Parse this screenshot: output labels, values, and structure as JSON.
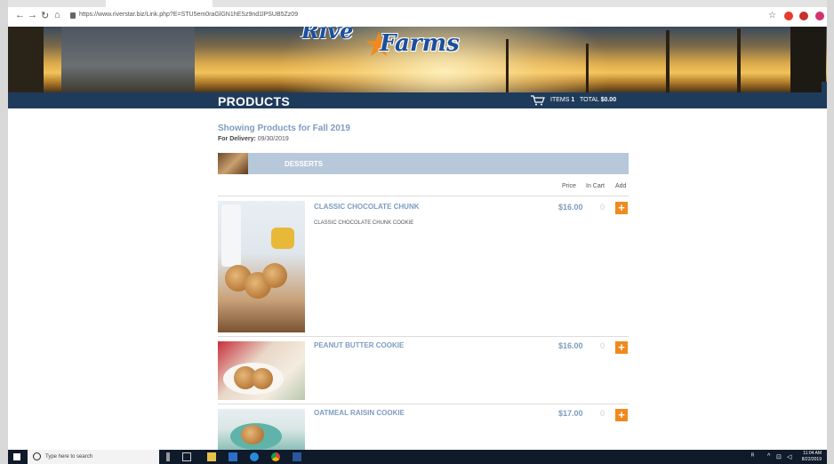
{
  "browser": {
    "url": "https://www.riverstar.biz/Link.php?E=STU5em0raGlGN1hESz9nd1lPSUB5Zz09",
    "back_icon": "back-arrow-icon",
    "forward_icon": "forward-arrow-icon",
    "reload_icon": "reload-icon",
    "home_icon": "home-icon"
  },
  "banner": {
    "logo_top": "Rive",
    "logo_text": "Farms"
  },
  "header": {
    "title": "PRODUCTS",
    "items_label": "ITEMS",
    "items_count": "1",
    "total_label": "TOTAL",
    "total_value": "$0.00"
  },
  "page": {
    "showing": "Showing Products for Fall 2019",
    "delivery_label": "For Delivery:",
    "delivery_date": "09/30/2019"
  },
  "category": {
    "name": "DESSERTS"
  },
  "columns": {
    "price": "Price",
    "in_cart": "In Cart",
    "add": "Add"
  },
  "products": [
    {
      "name": "CLASSIC CHOCOLATE CHUNK",
      "description": "CLASSIC CHOCOLATE CHUNK COOKIE",
      "price": "$16.00",
      "in_cart": "0"
    },
    {
      "name": "PEANUT BUTTER COOKIE",
      "description": "",
      "price": "$16.00",
      "in_cart": "0"
    },
    {
      "name": "OATMEAL RAISIN COOKIE",
      "description": "",
      "price": "$17.00",
      "in_cart": "0"
    }
  ],
  "taskbar": {
    "search_placeholder": "Type here to search",
    "time": "11:04 AM",
    "date": "8/22/2019"
  },
  "colors": {
    "navy": "#1f3b5c",
    "accent_orange": "#f08a1c",
    "link_blue": "#7d9cc0",
    "category_bg": "#b8c8db"
  }
}
